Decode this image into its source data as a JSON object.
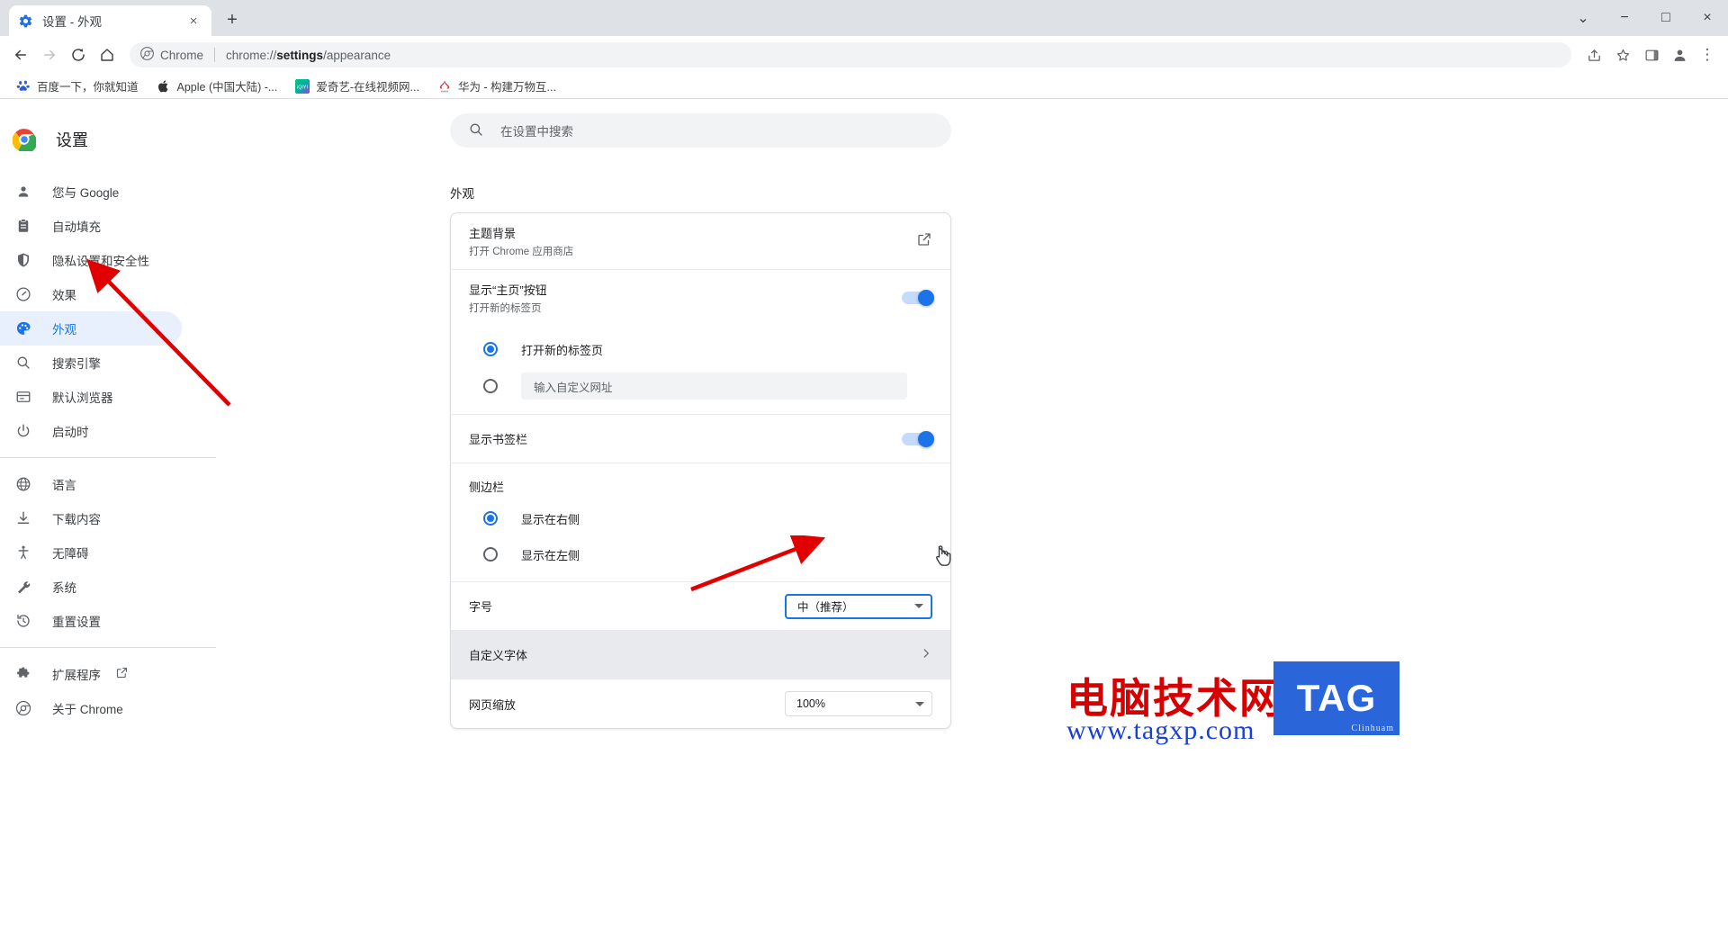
{
  "window": {
    "tab": {
      "title": "设置 - 外观",
      "favicon": "settings-gear-icon",
      "close": "×"
    },
    "newtab_label": "+",
    "controls": {
      "minimize_all": "⌄",
      "minimize": "−",
      "maximize": "□",
      "close": "×"
    }
  },
  "toolbar": {
    "back": "←",
    "forward": "→",
    "reload": "⟳",
    "home": "⌂",
    "site_chip": "Chrome",
    "url_prefix": "chrome://",
    "url_bold": "settings",
    "url_suffix": "/appearance",
    "share": "share-icon",
    "bookmark_star": "★",
    "side_panel": "side-panel-icon",
    "profile": "profile-avatar-icon",
    "menu": "⋮"
  },
  "bookmarks": [
    {
      "label": "百度一下，你就知道",
      "icon": "baidu-icon"
    },
    {
      "label": "Apple (中国大陆) -...",
      "icon": "apple-icon"
    },
    {
      "label": "爱奇艺-在线视频网...",
      "icon": "iqiyi-icon"
    },
    {
      "label": "华为 - 构建万物互...",
      "icon": "huawei-icon"
    }
  ],
  "sidebar": {
    "title": "设置",
    "items": [
      {
        "label": "您与 Google",
        "icon": "person-icon",
        "active": false
      },
      {
        "label": "自动填充",
        "icon": "clipboard-icon",
        "active": false
      },
      {
        "label": "隐私设置和安全性",
        "icon": "shield-icon",
        "active": false
      },
      {
        "label": "效果",
        "icon": "speedometer-icon",
        "active": false
      },
      {
        "label": "外观",
        "icon": "palette-icon",
        "active": true
      },
      {
        "label": "搜索引擎",
        "icon": "search-icon",
        "active": false
      },
      {
        "label": "默认浏览器",
        "icon": "browser-window-icon",
        "active": false
      },
      {
        "label": "启动时",
        "icon": "power-icon",
        "active": false
      }
    ],
    "items2": [
      {
        "label": "语言",
        "icon": "globe-icon"
      },
      {
        "label": "下载内容",
        "icon": "download-icon"
      },
      {
        "label": "无障碍",
        "icon": "accessibility-icon"
      },
      {
        "label": "系统",
        "icon": "wrench-icon"
      },
      {
        "label": "重置设置",
        "icon": "history-restore-icon"
      }
    ],
    "items3": [
      {
        "label": "扩展程序",
        "icon": "puzzle-icon",
        "external": true
      },
      {
        "label": "关于 Chrome",
        "icon": "chrome-icon",
        "external": false
      }
    ]
  },
  "search": {
    "placeholder": "在设置中搜索",
    "icon": "search-icon"
  },
  "main": {
    "section_title": "外观",
    "theme": {
      "primary": "主题背景",
      "secondary": "打开 Chrome 应用商店",
      "action_icon": "open-in-new-icon"
    },
    "home_button": {
      "primary": "显示“主页”按钮",
      "secondary": "打开新的标签页",
      "toggle_on": true,
      "options": [
        {
          "label": "打开新的标签页",
          "selected": true
        },
        {
          "label": "",
          "placeholder": "输入自定义网址",
          "selected": false
        }
      ]
    },
    "bookmarks_bar": {
      "primary": "显示书签栏",
      "toggle_on": true
    },
    "side_panel": {
      "group_label": "侧边栏",
      "options": [
        {
          "label": "显示在右侧",
          "selected": true
        },
        {
          "label": "显示在左侧",
          "selected": false
        }
      ]
    },
    "font_size": {
      "label": "字号",
      "value": "中（推荐）",
      "focused": true
    },
    "customize_fonts": {
      "label": "自定义字体",
      "chevron": "›",
      "hovered": true
    },
    "page_zoom": {
      "label": "网页缩放",
      "value": "100%"
    }
  },
  "watermark": {
    "line1": "电脑技术网",
    "line2": "www.tagxp.com",
    "badge": "TAG",
    "badge_sub": "Clinhuam"
  },
  "colors": {
    "accent": "#1a73e8",
    "titlebar": "#dee1e6",
    "hover_row": "#e8eaed",
    "active_nav": "#e8f0fe",
    "annotation": "#e00000"
  }
}
